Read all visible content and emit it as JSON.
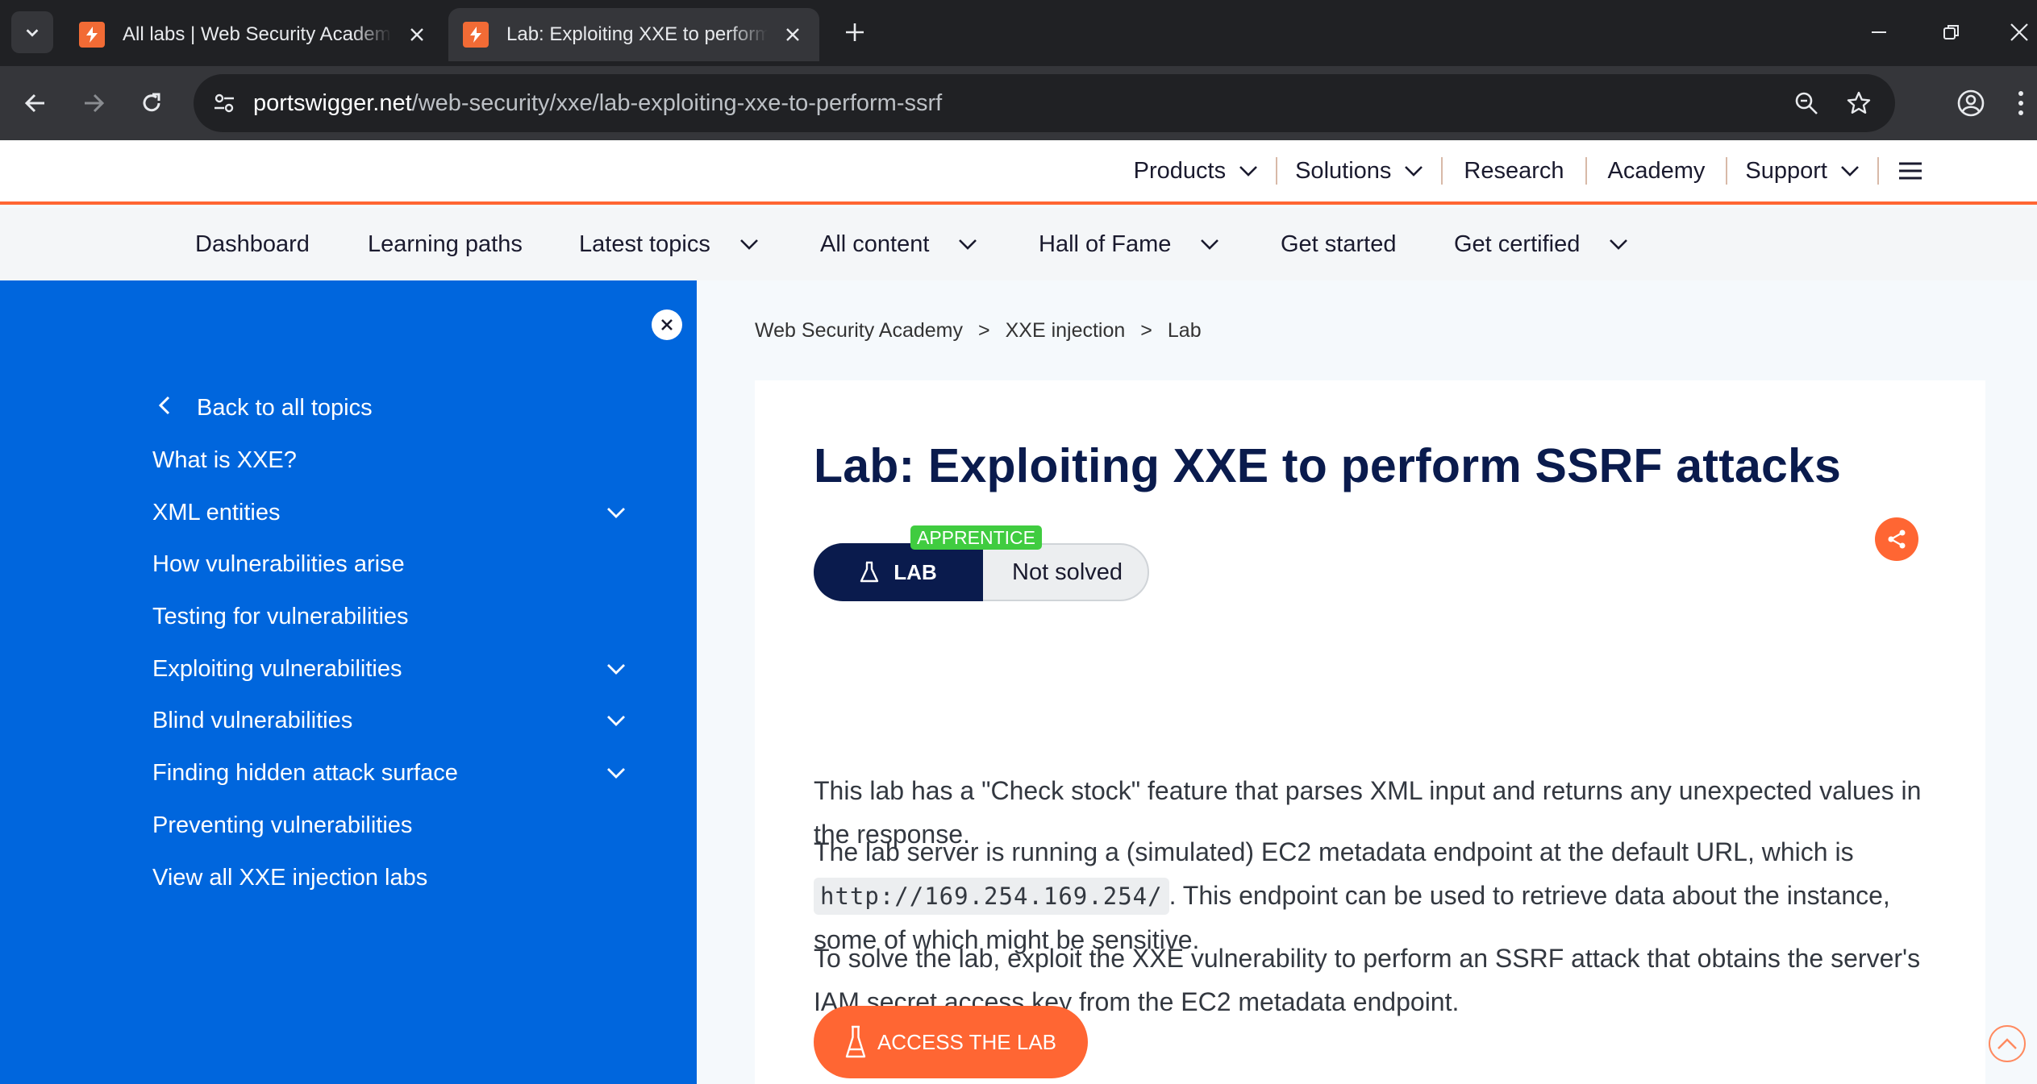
{
  "browser": {
    "tabs": [
      {
        "title": "All labs | Web Security Academy",
        "active": false
      },
      {
        "title": "Lab: Exploiting XXE to perform SSRF attacks",
        "active": true
      }
    ],
    "url_host": "portswigger.net",
    "url_path": "/web-security/xxe/lab-exploiting-xxe-to-perform-ssrf"
  },
  "topnav": {
    "items": [
      {
        "label": "Products",
        "has_menu": true
      },
      {
        "label": "Solutions",
        "has_menu": true
      },
      {
        "label": "Research",
        "has_menu": false
      },
      {
        "label": "Academy",
        "has_menu": false
      },
      {
        "label": "Support",
        "has_menu": true
      }
    ]
  },
  "subnav": {
    "items": [
      "Dashboard",
      "Learning paths",
      "Latest topics",
      "All content",
      "Hall of Fame",
      "Get started",
      "Get certified"
    ]
  },
  "sidebar": {
    "back_label": "Back to all topics",
    "items": [
      "What is XXE?",
      "XML entities",
      "How vulnerabilities arise",
      "Testing for vulnerabilities",
      "Exploiting vulnerabilities",
      "Blind vulnerabilities",
      "Finding hidden attack surface",
      "Preventing vulnerabilities",
      "View all XXE injection labs"
    ]
  },
  "breadcrumb": {
    "items": [
      "Web Security Academy",
      "XXE injection",
      "Lab"
    ],
    "separator": ">"
  },
  "lab": {
    "title": "Lab: Exploiting XXE to perform SSRF attacks",
    "type_label": "LAB",
    "level": "APPRENTICE",
    "status": "Not solved",
    "para1": "This lab has a \"Check stock\" feature that parses XML input and returns any unexpected values in the response.",
    "para2_before": "The lab server is running a (simulated) EC2 metadata endpoint at the default URL, which is ",
    "para2_code": "http://169.254.169.254/",
    "para2_after": ". This endpoint can be used to retrieve data about the instance, some of which might be sensitive.",
    "para3": "To solve the lab, exploit the XXE vulnerability to perform an SSRF attack that obtains the server's IAM secret access key from the EC2 metadata endpoint.",
    "access_label": "ACCESS THE LAB"
  },
  "colors": {
    "brand_orange": "#ff6633",
    "sidebar_blue": "#0066dd",
    "title_navy": "#0a1b4d",
    "level_green": "#40cc40"
  }
}
